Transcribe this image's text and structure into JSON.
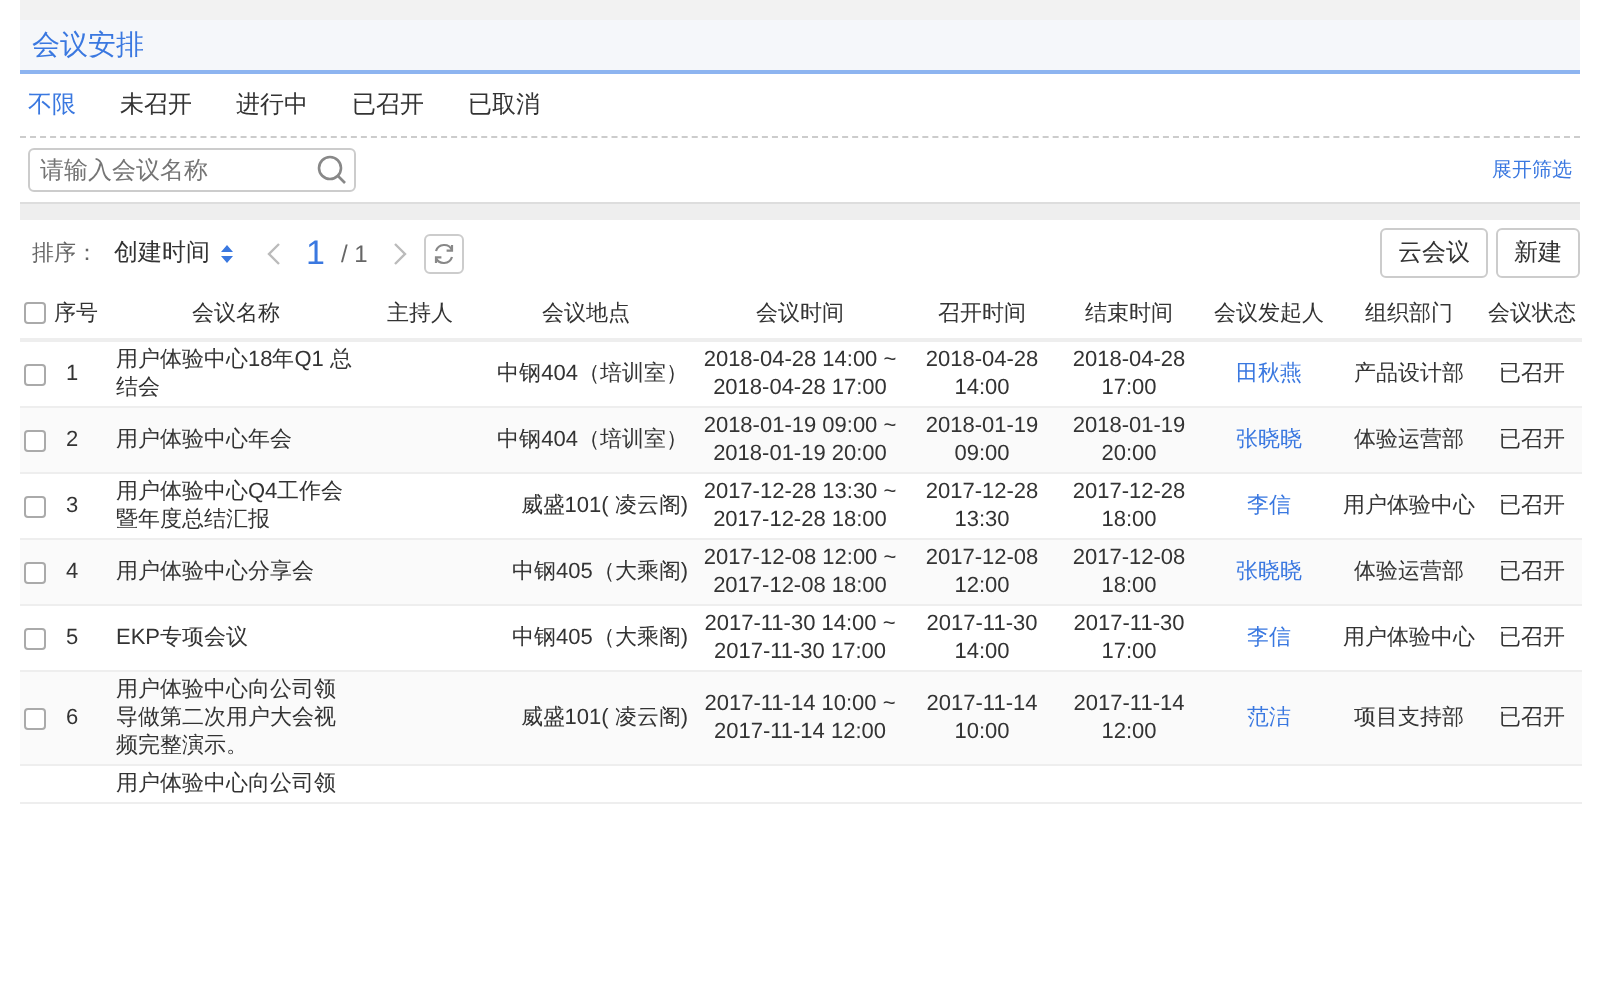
{
  "title": "会议安排",
  "status_tabs": [
    {
      "label": "不限",
      "selected": true
    },
    {
      "label": "未召开",
      "selected": false
    },
    {
      "label": "进行中",
      "selected": false
    },
    {
      "label": "已召开",
      "selected": false
    },
    {
      "label": "已取消",
      "selected": false
    }
  ],
  "search": {
    "placeholder": "请输入会议名称"
  },
  "expand_filter": "展开筛选",
  "sort": {
    "label": "排序：",
    "value": "创建时间"
  },
  "pagination": {
    "current": "1",
    "total": "/ 1"
  },
  "buttons": [
    "云会议",
    "新建"
  ],
  "table": {
    "select_all_checked": false,
    "columns": [
      "序号",
      "会议名称",
      "主持人",
      "会议地点",
      "会议时间",
      "召开时间",
      "结束时间",
      "会议发起人",
      "组织部门",
      "会议状态"
    ],
    "rows": [
      {
        "checked": false,
        "index": "1",
        "name": "用户体验中心18年Q1 总结会",
        "location": "中钢404（培训室）",
        "time": "2018-04-28 14:00 ~ 2018-04-28 17:00",
        "start": "2018-04-28 14:00",
        "end": "2018-04-28 17:00",
        "initiator": "田秋燕",
        "department": "产品设计部",
        "status": "已召开"
      },
      {
        "checked": false,
        "index": "2",
        "name": "用户体验中心年会",
        "location": "中钢404（培训室）",
        "time": "2018-01-19 09:00 ~ 2018-01-19 20:00",
        "start": "2018-01-19 09:00",
        "end": "2018-01-19 20:00",
        "initiator": "张晓晓",
        "department": "体验运营部",
        "status": "已召开"
      },
      {
        "checked": false,
        "index": "3",
        "name": "用户体验中心Q4工作会暨年度总结汇报",
        "location": "威盛101( 凌云阁)",
        "time": "2017-12-28 13:30 ~ 2017-12-28 18:00",
        "start": "2017-12-28 13:30",
        "end": "2017-12-28 18:00",
        "initiator": "李信",
        "department": "用户体验中心",
        "status": "已召开"
      },
      {
        "checked": false,
        "index": "4",
        "name": "用户体验中心分享会",
        "location": "中钢405（大乘阁)",
        "time": "2017-12-08 12:00 ~ 2017-12-08 18:00",
        "start": "2017-12-08 12:00",
        "end": "2017-12-08 18:00",
        "initiator": "张晓晓",
        "department": "体验运营部",
        "status": "已召开"
      },
      {
        "checked": false,
        "index": "5",
        "name": "EKP专项会议",
        "location": "中钢405（大乘阁)",
        "time": "2017-11-30 14:00 ~ 2017-11-30 17:00",
        "start": "2017-11-30 14:00",
        "end": "2017-11-30 17:00",
        "initiator": "李信",
        "department": "用户体验中心",
        "status": "已召开"
      },
      {
        "checked": false,
        "index": "6",
        "name": "用户体验中心向公司领导做第二次用户大会视频完整演示。",
        "location": "威盛101( 凌云阁)",
        "time": "2017-11-14 10:00 ~ 2017-11-14 12:00",
        "start": "2017-11-14 10:00",
        "end": "2017-11-14 12:00",
        "initiator": "范洁",
        "department": "项目支持部",
        "status": "已召开"
      },
      {
        "name": "用户体验中心向公司领"
      }
    ]
  }
}
